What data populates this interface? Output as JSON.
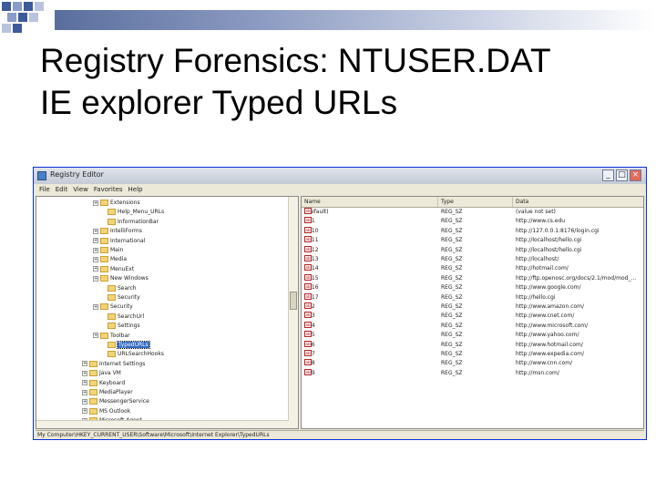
{
  "slide": {
    "title": "Registry Forensics: NTUSER.DAT\nIE explorer Typed URLs"
  },
  "window": {
    "title": "Registry Editor",
    "menu": [
      "File",
      "Edit",
      "View",
      "Favorites",
      "Help"
    ],
    "controls": {
      "minimize": "_",
      "maximize": "□",
      "close": "×"
    }
  },
  "tree": {
    "items": [
      {
        "label": "Extensions",
        "expander": "+"
      },
      {
        "label": "Help_Menu_URLs",
        "expander": ""
      },
      {
        "label": "InformationBar",
        "expander": ""
      },
      {
        "label": "IntelliForms",
        "expander": "+"
      },
      {
        "label": "International",
        "expander": "+"
      },
      {
        "label": "Main",
        "expander": "+"
      },
      {
        "label": "Media",
        "expander": "+"
      },
      {
        "label": "MenuExt",
        "expander": "+"
      },
      {
        "label": "New Windows",
        "expander": "+"
      },
      {
        "label": "Search",
        "expander": ""
      },
      {
        "label": "Security",
        "expander": ""
      },
      {
        "label": "Security",
        "expander": "+"
      },
      {
        "label": "SearchUrl",
        "expander": ""
      },
      {
        "label": "Settings",
        "expander": ""
      },
      {
        "label": "Toolbar",
        "expander": "+"
      },
      {
        "label": "TypedURLs",
        "expander": "",
        "selected": true
      },
      {
        "label": "URLSearchHooks",
        "expander": ""
      },
      {
        "label": "Internet Settings",
        "expander": "+"
      },
      {
        "label": "Java VM",
        "expander": "+"
      },
      {
        "label": "Keyboard",
        "expander": "+"
      },
      {
        "label": "MediaPlayer",
        "expander": "+"
      },
      {
        "label": "MessengerService",
        "expander": "+"
      },
      {
        "label": "MS Outlook",
        "expander": "+"
      },
      {
        "label": "Microsoft Agent",
        "expander": "+"
      }
    ]
  },
  "list": {
    "headers": [
      "Name",
      "Type",
      "Data"
    ],
    "rows": [
      {
        "name": "(Default)",
        "type": "REG_SZ",
        "data": "(value not set)"
      },
      {
        "name": "url1",
        "type": "REG_SZ",
        "data": "http://www.cs.edu"
      },
      {
        "name": "url10",
        "type": "REG_SZ",
        "data": "http://127.0.0.1:8176/login.cgi"
      },
      {
        "name": "url11",
        "type": "REG_SZ",
        "data": "http://localhost/hello.cgi"
      },
      {
        "name": "url12",
        "type": "REG_SZ",
        "data": "http://localhost/hello.cgi"
      },
      {
        "name": "url13",
        "type": "REG_SZ",
        "data": "http://localhost/"
      },
      {
        "name": "url14",
        "type": "REG_SZ",
        "data": "http://hotmail.com/"
      },
      {
        "name": "url15",
        "type": "REG_SZ",
        "data": "http://ftp.openosc.org/docs/2.1/mod/mod_..."
      },
      {
        "name": "url16",
        "type": "REG_SZ",
        "data": "http://www.google.com/"
      },
      {
        "name": "url17",
        "type": "REG_SZ",
        "data": "http://hello.cgi"
      },
      {
        "name": "url2",
        "type": "REG_SZ",
        "data": "http://www.amazon.com/"
      },
      {
        "name": "url3",
        "type": "REG_SZ",
        "data": "http://www.cnet.com/"
      },
      {
        "name": "url4",
        "type": "REG_SZ",
        "data": "http://www.microsoft.com/"
      },
      {
        "name": "url5",
        "type": "REG_SZ",
        "data": "http://www.yahoo.com/"
      },
      {
        "name": "url6",
        "type": "REG_SZ",
        "data": "http://www.hotmail.com/"
      },
      {
        "name": "url7",
        "type": "REG_SZ",
        "data": "http://www.expedia.com/"
      },
      {
        "name": "url8",
        "type": "REG_SZ",
        "data": "http://www.cnn.com/"
      },
      {
        "name": "url9",
        "type": "REG_SZ",
        "data": "http://msn.com/"
      }
    ]
  },
  "statusbar": {
    "path": "My Computer\\HKEY_CURRENT_USER\\Software\\Microsoft\\Internet Explorer\\TypedURLs"
  },
  "colors": {
    "accent": "#316ac5",
    "title_bar": "#0831d9",
    "folder": "#f2d378"
  }
}
